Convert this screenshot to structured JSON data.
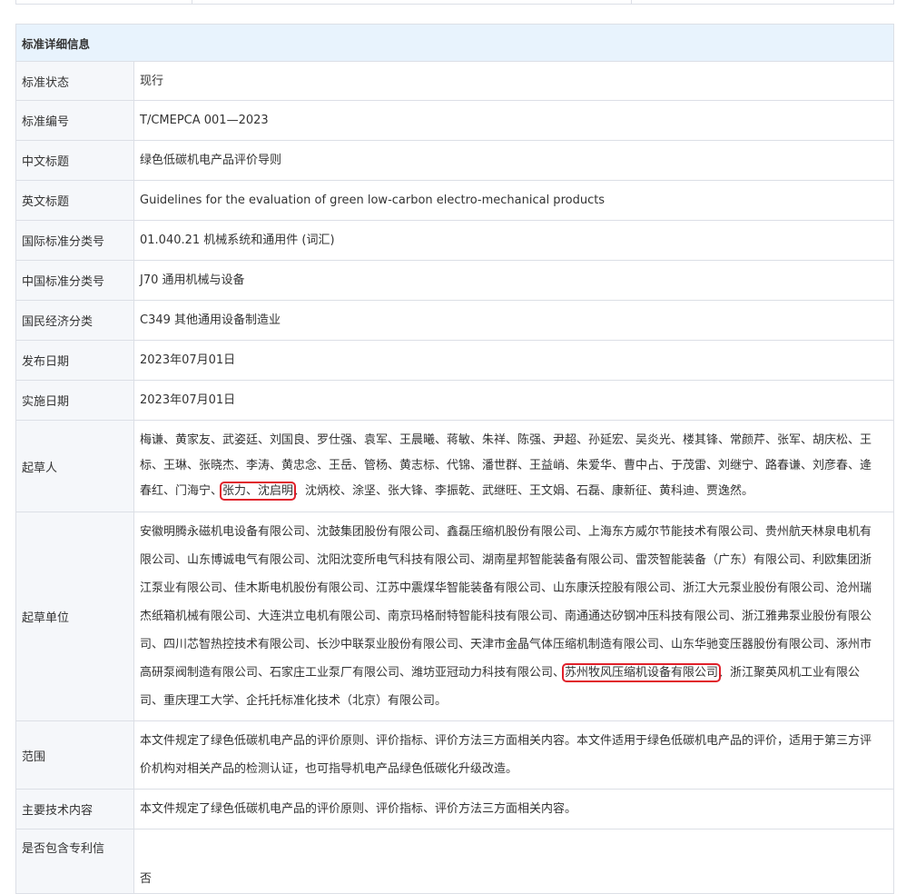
{
  "section_title": "标准详细信息",
  "rows": {
    "status": {
      "label": "标准状态",
      "value": "现行"
    },
    "number": {
      "label": "标准编号",
      "value": "T/CMEPCA 001—2023"
    },
    "cn_title": {
      "label": "中文标题",
      "value": "绿色低碳机电产品评价导则"
    },
    "en_title": {
      "label": "英文标题",
      "value": "Guidelines for the evaluation of green low-carbon electro-mechanical products"
    },
    "ics": {
      "label": "国际标准分类号",
      "value": "01.040.21 机械系统和通用件 (词汇)"
    },
    "ccs": {
      "label": "中国标准分类号",
      "value": "J70 通用机械与设备"
    },
    "economy": {
      "label": "国民经济分类",
      "value": "C349 其他通用设备制造业"
    },
    "publish_date": {
      "label": "发布日期",
      "value": "2023年07月01日"
    },
    "impl_date": {
      "label": "实施日期",
      "value": "2023年07月01日"
    },
    "drafters": {
      "label": "起草人",
      "before": "梅谦、黄家友、武姿廷、刘国良、罗仕强、袁军、王晨曦、蒋敏、朱祥、陈强、尹超、孙延宏、吴炎光、楼其锋、常颜芹、张军、胡庆松、王标、王琳、张晓杰、李涛、黄忠念、王岳、管杨、黄志标、代锦、潘世群、王益峭、朱爱华、曹中占、于茂雷、刘继宁、路春谦、刘彦春、逄春红、门海宁、",
      "highlight": "张力、沈启明",
      "after": "、沈炳校、涂坚、张大锋、李振乾、武继旺、王文娟、石磊、康新征、黄科迪、贾逸然。"
    },
    "units": {
      "label": "起草单位",
      "before": "安徽明腾永磁机电设备有限公司、沈鼓集团股份有限公司、鑫磊压缩机股份有限公司、上海东方威尔节能技术有限公司、贵州航天林泉电机有限公司、山东博诚电气有限公司、沈阳沈变所电气科技有限公司、湖南星邦智能装备有限公司、雷茨智能装备（广东）有限公司、利欧集团浙江泵业有限公司、佳木斯电机股份有限公司、江苏中震煤华智能装备有限公司、山东康沃控股有限公司、浙江大元泵业股份有限公司、沧州瑞杰纸箱机械有限公司、大连洪立电机有限公司、南京玛格耐特智能科技有限公司、南通通达矽钢冲压科技有限公司、浙江雅弗泵业股份有限公司、四川芯智热控技术有限公司、长沙中联泵业股份有限公司、天津市金晶气体压缩机制造有限公司、山东华驰变压器股份有限公司、涿州市高研泵阀制造有限公司、石家庄工业泵厂有限公司、潍坊亚冠动力科技有限公司、",
      "highlight": "苏州牧风压缩机设备有限公司",
      "after": "、浙江聚英风机工业有限公司、重庆理工大学、企托托标准化技术（北京）有限公司。"
    },
    "scope": {
      "label": "范围",
      "value": "本文件规定了绿色低碳机电产品的评价原则、评价指标、评价方法三方面相关内容。本文件适用于绿色低碳机电产品的评价，适用于第三方评价机构对相关产品的检测认证，也可指导机电产品绿色低碳化升级改造。"
    },
    "main_content": {
      "label": "主要技术内容",
      "value": "本文件规定了绿色低碳机电产品的评价原则、评价指标、评价方法三方面相关内容。"
    },
    "patent": {
      "label": "是否包含专利信",
      "value": "否"
    }
  }
}
